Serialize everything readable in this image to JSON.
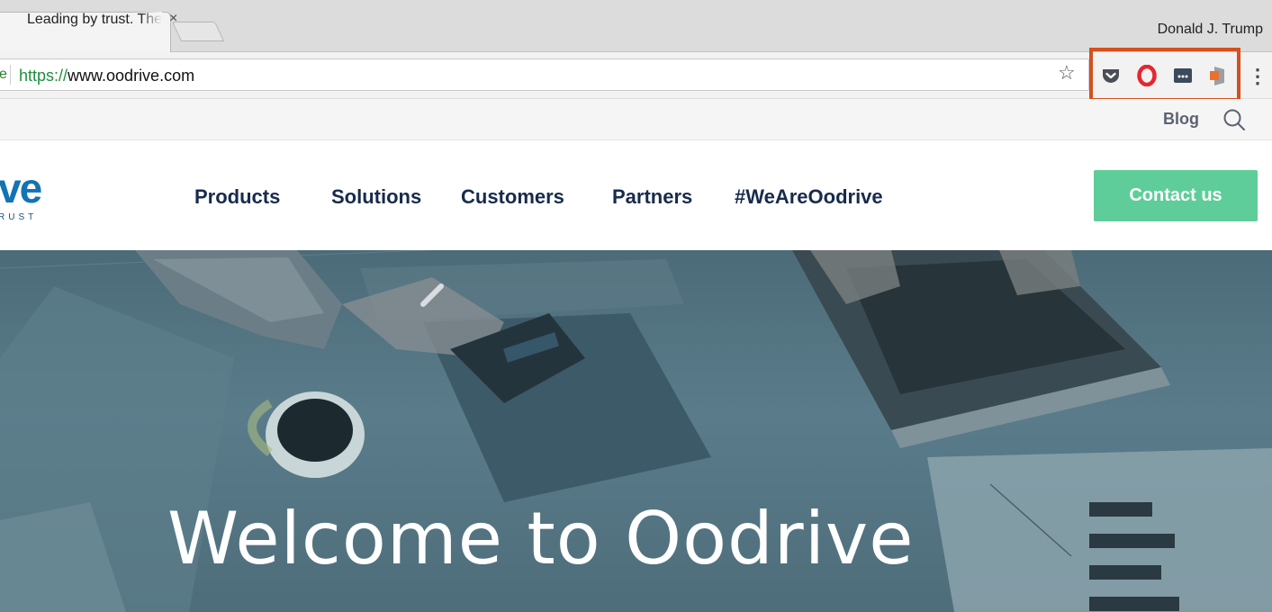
{
  "browser": {
    "tab_title": "Leading by trust. The",
    "tab_close": "×",
    "profile_name": "Donald J. Trump",
    "url_scheme": "https://",
    "url_host": "www.oodrive.com",
    "star": "☆",
    "menu": "⋮",
    "highlight_color": "#d4501f",
    "extensions": [
      "pocket-icon",
      "opera-icon",
      "password-manager-icon",
      "office-icon"
    ]
  },
  "site": {
    "blog_label": "Blog",
    "logo_word": "ve",
    "logo_sub": "RUST",
    "nav": [
      "Products",
      "Solutions",
      "Customers",
      "Partners",
      "#WeAreOodrive"
    ],
    "contact_label": "Contact us",
    "hero_title": "Welcome to Oodrive",
    "colors": {
      "accent": "#5fcd99",
      "logo": "#1273b5",
      "nav_text": "#172b4d"
    }
  }
}
